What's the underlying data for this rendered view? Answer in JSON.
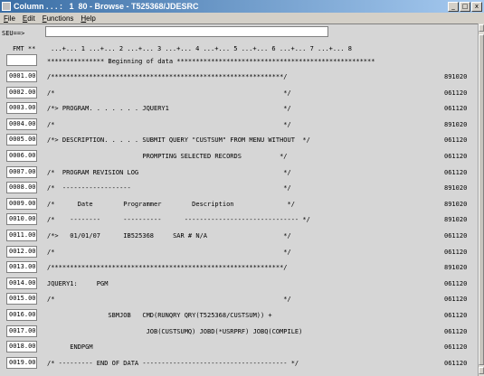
{
  "window": {
    "title": "Column . . . :   1  80 - Browse - T525368/JDESRC",
    "min_label": "_",
    "max_label": "□",
    "close_label": "x"
  },
  "menu": {
    "items": [
      {
        "accel": "F",
        "rest": "ile"
      },
      {
        "accel": "E",
        "rest": "dit"
      },
      {
        "accel": "F",
        "rest": "unctions"
      },
      {
        "accel": "H",
        "rest": "elp"
      }
    ]
  },
  "seu": {
    "label": "SEU==>",
    "command_value": ""
  },
  "format": {
    "label": "FMT **",
    "ruler": "...+... 1 ...+... 2 ...+... 3 ...+... 4 ...+... 5 ...+... 6 ...+... 7 ...+... 8",
    "beginning": "*************** Beginning of data ****************************************************"
  },
  "lines": [
    {
      "seq": "0001.00",
      "src": "/*************************************************************/",
      "date": "891020"
    },
    {
      "seq": "0002.00",
      "src": "/*                                                            */",
      "date": "061120"
    },
    {
      "seq": "0003.00",
      "src": "/*> PROGRAM. . . . . . . JQUERY1                              */",
      "date": "061120"
    },
    {
      "seq": "0004.00",
      "src": "/*                                                            */",
      "date": "891020"
    },
    {
      "seq": "0005.00",
      "src": "/*> DESCRIPTION. . . . . SUBMIT QUERY \"CUSTSUM\" FROM MENU WITHOUT  */",
      "date": "061120"
    },
    {
      "seq": "0006.00",
      "src": "                         PROMPTING SELECTED RECORDS          */",
      "date": "061120"
    },
    {
      "seq": "0007.00",
      "src": "/*  PROGRAM REVISION LOG                                      */",
      "date": "061120"
    },
    {
      "seq": "0008.00",
      "src": "/*  ------------------                                        */",
      "date": "891020"
    },
    {
      "seq": "0009.00",
      "src": "/*      Date        Programmer        Description              */",
      "date": "891020"
    },
    {
      "seq": "0010.00",
      "src": "/*    --------      ----------      ------------------------------ */",
      "date": "891020"
    },
    {
      "seq": "0011.00",
      "src": "/*>   01/01/07      IB525368     SAR # N/A                    */",
      "date": "061120"
    },
    {
      "seq": "0012.00",
      "src": "/*                                                            */",
      "date": "061120"
    },
    {
      "seq": "0013.00",
      "src": "/*************************************************************/",
      "date": "891020"
    },
    {
      "seq": "0014.00",
      "src": "JQUERY1:     PGM",
      "date": "061120"
    },
    {
      "seq": "0015.00",
      "src": "/*                                                            */",
      "date": "061120"
    },
    {
      "seq": "0016.00",
      "src": "                SBMJOB   CMD(RUNQRY QRY(T525368/CUSTSUM)) +",
      "date": "061120"
    },
    {
      "seq": "0017.00",
      "src": "                          JOB(CUSTSUMQ) JOBD(*USRPRF) JOBQ(COMPILE)",
      "date": "061120"
    },
    {
      "seq": "0018.00",
      "src": "      ENDPGM",
      "date": "061120"
    },
    {
      "seq": "0019.00",
      "src": "/* --------- END OF DATA -------------------------------------- */",
      "date": "061120"
    }
  ]
}
